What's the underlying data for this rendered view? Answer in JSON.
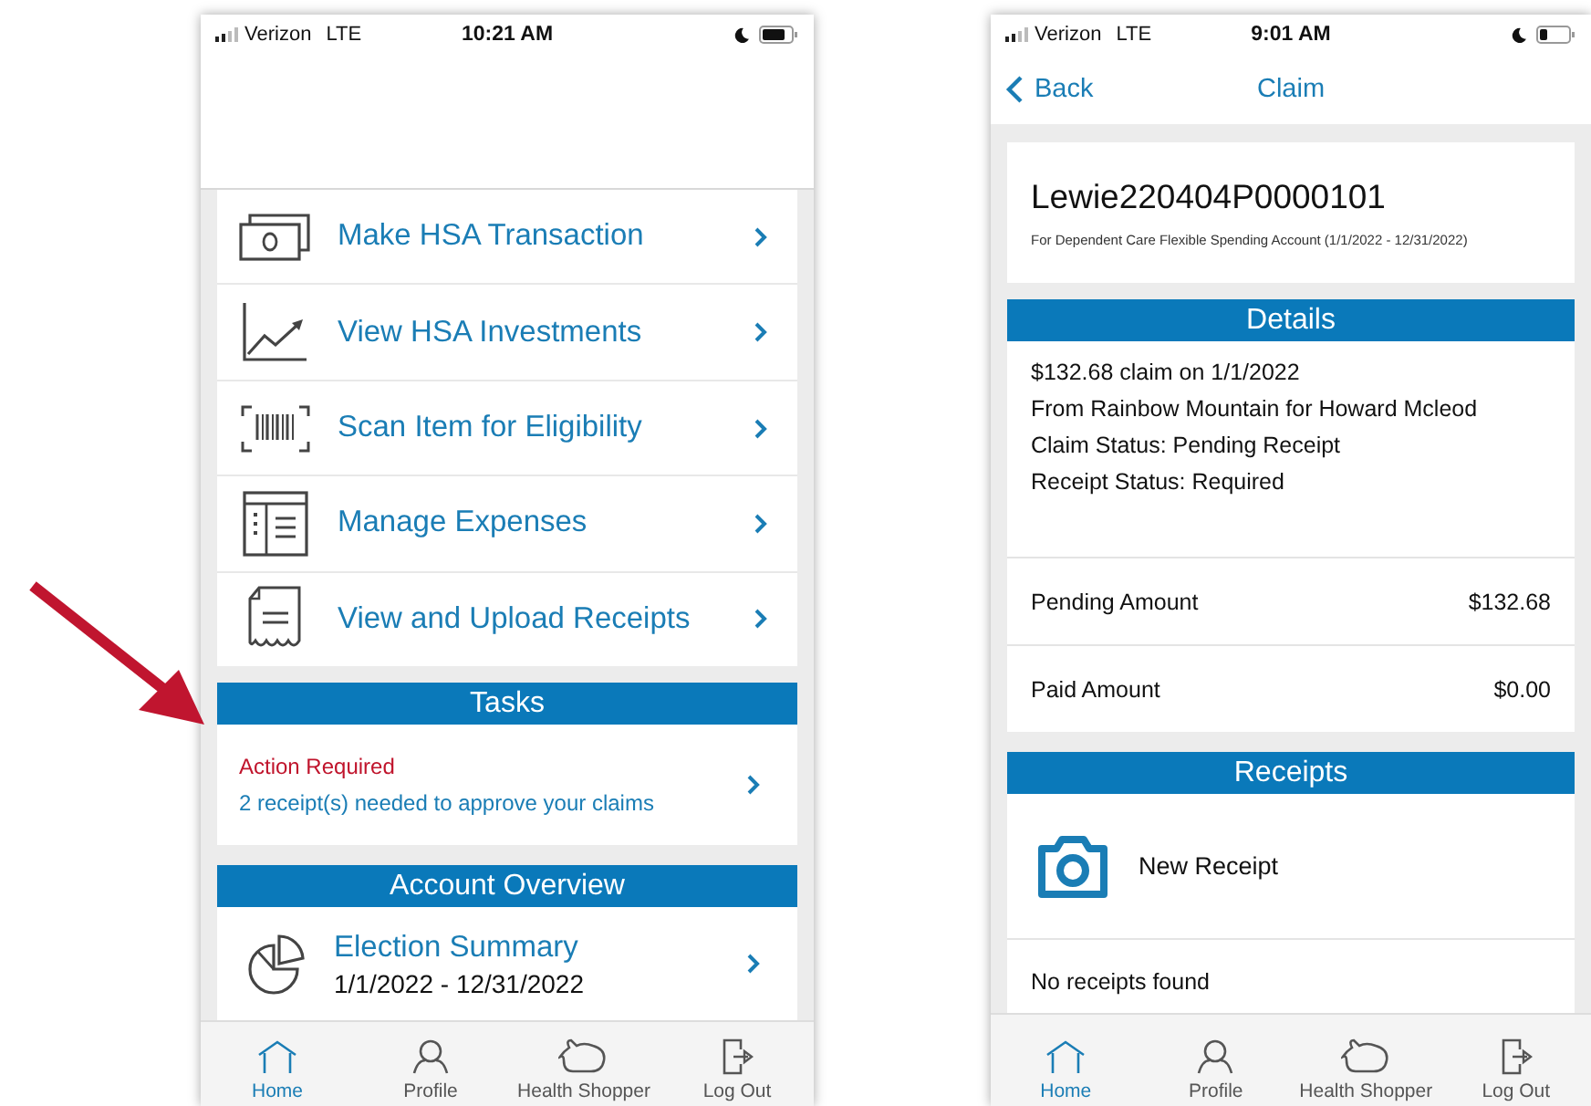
{
  "home_screen": {
    "status_bar": {
      "carrier": "Verizon",
      "network": "LTE",
      "time": "10:21 AM"
    },
    "menu_items": [
      {
        "label": "Make HSA Transaction"
      },
      {
        "label": "View HSA Investments"
      },
      {
        "label": "Scan Item for Eligibility"
      },
      {
        "label": "Manage Expenses"
      },
      {
        "label": "View and Upload Receipts"
      }
    ],
    "tasks": {
      "title": "Tasks",
      "alert": "Action Required",
      "message": "2 receipt(s) needed to approve your claims"
    },
    "account_overview": {
      "title": "Account Overview",
      "item": "Election Summary",
      "period": "1/1/2022 - 12/31/2022"
    },
    "tab_bar": [
      {
        "label": "Home",
        "selected": true
      },
      {
        "label": "Profile",
        "selected": false
      },
      {
        "label": "Health Shopper",
        "selected": false
      },
      {
        "label": "Log Out",
        "selected": false
      }
    ]
  },
  "claim_screen": {
    "status_bar": {
      "carrier": "Verizon",
      "network": "LTE",
      "time": "9:01 AM"
    },
    "nav": {
      "back": "Back",
      "title": "Claim"
    },
    "claim": {
      "id": "Lewie220404P0000101",
      "account": "For Dependent Care Flexible Spending Account (1/1/2022 - 12/31/2022)"
    },
    "details": {
      "title": "Details",
      "lines": [
        [
          "$132.68 claim on 1/1/2022",
          "From Rainbow Mountain for Howard Mcleod"
        ],
        [
          "Claim Status: Pending Receipt",
          "Receipt Status: Required"
        ]
      ],
      "amounts": [
        {
          "label": "Pending Amount",
          "value": "$132.68"
        },
        {
          "label": "Paid Amount",
          "value": "$0.00"
        }
      ]
    },
    "receipts": {
      "title": "Receipts",
      "action": "New Receipt",
      "empty": "No receipts found"
    },
    "tab_bar": [
      {
        "label": "Home",
        "selected": true
      },
      {
        "label": "Profile",
        "selected": false
      },
      {
        "label": "Health Shopper",
        "selected": false
      },
      {
        "label": "Log Out",
        "selected": false
      }
    ]
  }
}
